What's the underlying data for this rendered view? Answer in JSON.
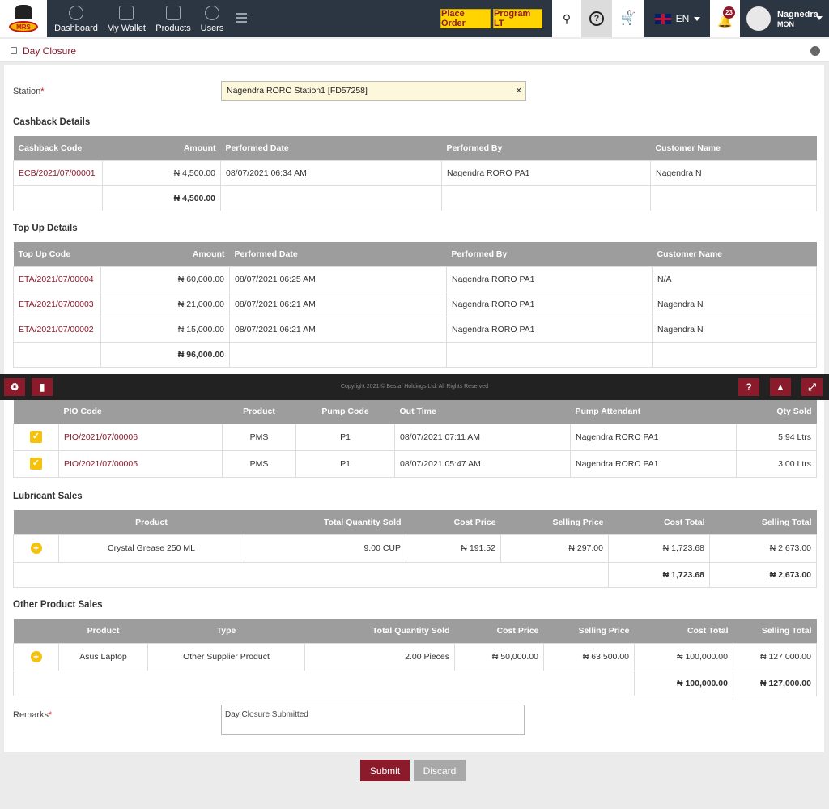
{
  "nav": {
    "items": [
      {
        "label": "Dashboard"
      },
      {
        "label": "My Wallet"
      },
      {
        "label": "Products"
      },
      {
        "label": "Users"
      }
    ],
    "place_order": "Place Order",
    "program": "Program LT",
    "cart_count": "0",
    "language": "EN",
    "notif_count": "23",
    "user_name": "Nagnedra",
    "user_company": "MON",
    "logo_text": "MRS"
  },
  "page": {
    "title": "Day Closure"
  },
  "form": {
    "station_label": "Station",
    "station_value": "Nagendra RORO Station1 [FD57258]",
    "remarks_label": "Remarks",
    "remarks_value": "Day Closure Submitted",
    "required_mark": "*"
  },
  "cashback": {
    "title": "Cashback Details",
    "headers": [
      "Cashback Code",
      "Amount",
      "Performed Date",
      "Performed By",
      "Customer Name"
    ],
    "rows": [
      [
        "ECB/2021/07/00001",
        "₦ 4,500.00",
        "08/07/2021 06:34 AM",
        "Nagendra RORO PA1",
        "Nagendra N"
      ]
    ],
    "total": "₦ 4,500.00"
  },
  "topup": {
    "title": "Top Up Details",
    "headers": [
      "Top Up Code",
      "Amount",
      "Performed Date",
      "Performed By",
      "Customer Name"
    ],
    "rows": [
      [
        "ETA/2021/07/00004",
        "₦ 60,000.00",
        "08/07/2021 06:25 AM",
        "Nagendra RORO PA1",
        "N/A"
      ],
      [
        "ETA/2021/07/00003",
        "₦ 21,000.00",
        "08/07/2021 06:21 AM",
        "Nagendra RORO PA1",
        "Nagendra N"
      ],
      [
        "ETA/2021/07/00002",
        "₦ 15,000.00",
        "08/07/2021 06:21 AM",
        "Nagendra RORO PA1",
        "Nagendra N"
      ]
    ],
    "total": "₦ 96,000.00"
  },
  "footer": {
    "copyright": "Copyright 2021 © Bestaf Holdings Ltd. All Rights Reserved"
  },
  "pio": {
    "headers": [
      "PIO Code",
      "Product",
      "Pump Code",
      "Out Time",
      "Pump Attendant",
      "Qty Sold"
    ],
    "rows": [
      [
        "PIO/2021/07/00006",
        "PMS",
        "P1",
        "08/07/2021 07:11 AM",
        "Nagendra RORO PA1",
        "5.94 Ltrs"
      ],
      [
        "PIO/2021/07/00005",
        "PMS",
        "P1",
        "08/07/2021 05:47 AM",
        "Nagendra RORO PA1",
        "3.00 Ltrs"
      ]
    ]
  },
  "lubricant": {
    "title": "Lubricant Sales",
    "headers": [
      "Product",
      "Total Quantity Sold",
      "Cost Price",
      "Selling Price",
      "Cost Total",
      "Selling Total"
    ],
    "rows": [
      [
        "Crystal Grease 250 ML",
        "9.00 CUP",
        "₦ 191.52",
        "₦ 297.00",
        "₦ 1,723.68",
        "₦ 2,673.00"
      ]
    ],
    "cost_total": "₦ 1,723.68",
    "selling_total": "₦ 2,673.00"
  },
  "other": {
    "title": "Other Product Sales",
    "headers": [
      "Product",
      "Type",
      "Total Quantity Sold",
      "Cost Price",
      "Selling Price",
      "Cost Total",
      "Selling Total"
    ],
    "rows": [
      [
        "Asus Laptop",
        "Other Supplier Product",
        "2.00 Pieces",
        "₦ 50,000.00",
        "₦ 63,500.00",
        "₦ 100,000.00",
        "₦ 127,000.00"
      ]
    ],
    "cost_total": "₦ 100,000.00",
    "selling_total": "₦ 127,000.00"
  },
  "actions": {
    "submit": "Submit",
    "discard": "Discard"
  },
  "colors": {
    "accent": "#8b1a2b",
    "topbar": "#2c3542",
    "yellow": "#ffd400",
    "header_gray": "#9d9d9d"
  }
}
